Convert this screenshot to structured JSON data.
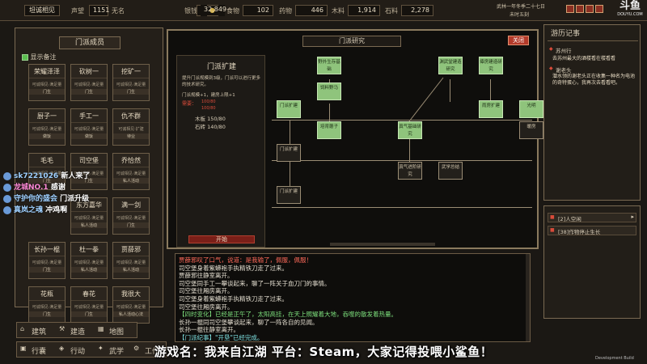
{
  "top": {
    "status": "坦诚相见",
    "rep_label": "声望",
    "rep_value": "1151",
    "rep_level": "无名",
    "resources": [
      {
        "label": "银钱",
        "value": ""
      },
      {
        "label": "",
        "value": "32,849"
      },
      {
        "label": "食物",
        "value": "102"
      },
      {
        "label": "药物",
        "value": "446"
      },
      {
        "label": "木料",
        "value": "1,914"
      },
      {
        "label": "石料",
        "value": "2,278"
      }
    ],
    "date_line": "武林一年冬季二十七日",
    "time_line": "未时五刻",
    "platform": "斗鱼",
    "platform_sub": "DOUYU.COM"
  },
  "sidebar": {
    "title": "门派成员",
    "show_notes": "显示备注",
    "members": [
      {
        "name": "荣耀泽泽",
        "s1": "可诚相见·满足量",
        "s2": "门生"
      },
      {
        "name": "砍树一",
        "s1": "可诚相见·满足量",
        "s2": "门生"
      },
      {
        "name": "挖矿一",
        "s1": "可诚相见·满足量",
        "s2": "门生"
      },
      {
        "name": "厨子一",
        "s1": "可诚相见·满足量",
        "s2": "做饭"
      },
      {
        "name": "手工一",
        "s1": "可诚相见·满足量",
        "s2": "做饭"
      },
      {
        "name": "仇不群",
        "s1": "可诚相见·扩建",
        "s2": "待业"
      },
      {
        "name": "毛毛",
        "s1": "可诚相见·满足量",
        "s2": "门生"
      },
      {
        "name": "司空堡",
        "s1": "可诚相见·满足量",
        "s2": "门生"
      },
      {
        "name": "乔恰然",
        "s1": "可诚相见·满足量",
        "s2": "私人活动"
      },
      {
        "name": "",
        "s1": "",
        "s2": ""
      },
      {
        "name": "东方嘉华",
        "s1": "可诚相见·满足量",
        "s2": "私人活动"
      },
      {
        "name": "满一剑",
        "s1": "可诚相见·满足量",
        "s2": "门生"
      },
      {
        "name": "长孙一棍",
        "s1": "可诚相见·满足量",
        "s2": "门生"
      },
      {
        "name": "杜一拳",
        "s1": "可诚相见·满足量",
        "s2": "私人活动"
      },
      {
        "name": "贾薛邪",
        "s1": "可诚相见·满足量",
        "s2": "私人活动"
      },
      {
        "name": "花瓶",
        "s1": "可诚相见·满足量",
        "s2": "门生"
      },
      {
        "name": "春花",
        "s1": "可诚相见·满足量",
        "s2": "门生"
      },
      {
        "name": "我很大",
        "s1": "可诚相见·满足量",
        "s2": "私人活动心法"
      }
    ],
    "menu1": [
      "建筑",
      "建造",
      "地图"
    ],
    "menu2": [
      "行囊",
      "行动",
      "武学",
      "工作"
    ]
  },
  "research": {
    "title": "门派研究",
    "close": "关闭",
    "detail": {
      "title": "门派扩建",
      "desc": "提升门派规模到3级，门派可以进行更多的技术研究。",
      "effects": "门派规模+1，建房上限+1",
      "need_label": "需要：",
      "need1": "100/80",
      "need2": "100/80",
      "wood": "木板  150/80",
      "stone": "石砖  140/80",
      "start": "开始"
    },
    "nodes": [
      {
        "id": "n1",
        "label": "野外生存基础",
        "dark": false
      },
      {
        "id": "n2",
        "label": "渊武堂建造研究",
        "dark": false
      },
      {
        "id": "n3",
        "label": "瘴房建造研究",
        "dark": false
      },
      {
        "id": "n4",
        "label": "门派扩建",
        "dark": false
      },
      {
        "id": "n5",
        "label": "饲料野马",
        "dark": false
      },
      {
        "id": "n6",
        "label": "雨房扩建",
        "dark": false
      },
      {
        "id": "n7",
        "label": "光明",
        "dark": false
      },
      {
        "id": "n8",
        "label": "培育蘑子",
        "dark": false
      },
      {
        "id": "n9",
        "label": "真气基础研究",
        "dark": false
      },
      {
        "id": "n10",
        "label": "门派扩建",
        "dark": true
      },
      {
        "id": "n11",
        "label": "暖房",
        "dark": true
      },
      {
        "id": "n12",
        "label": "真气进阶研究",
        "dark": true
      },
      {
        "id": "n13",
        "label": "武学总结",
        "dark": true
      },
      {
        "id": "n14",
        "label": "门派扩建",
        "dark": true
      }
    ]
  },
  "log": [
    {
      "text": "贾薛邪叹了口气，说道：是我输了，佩服，佩服！",
      "color": "#ff6a5a"
    },
    {
      "text": "司空堡身着紫蟒袍手执精铁刀走了过来。",
      "color": "#e6e0d2"
    },
    {
      "text": "贾薛邪往静室离开。",
      "color": "#e6e0d2"
    },
    {
      "text": "司空堡同手工一攀谈起来，聊了一阵关于血刀门的事情。",
      "color": "#e6e0d2"
    },
    {
      "text": "司空堡往厢房离开。",
      "color": "#e6e0d2"
    },
    {
      "text": "司空堡身着紫蟒袍手执精铁刀走了过来。",
      "color": "#e6e0d2"
    },
    {
      "text": "司空堡往厢房离开。",
      "color": "#e6e0d2"
    },
    {
      "text": "【四时变化】已经是正午了，太阳高挂，在天上照耀着大地，吞噬的散发着热量。",
      "color": "#7de07d"
    },
    {
      "text": "长孙一棍同司空堡攀谈起来，聊了一阵各自的见闻。",
      "color": "#e6e0d2"
    },
    {
      "text": "长孙一棍往静室离开。",
      "color": "#e6e0d2"
    },
    {
      "text": "【门派纪事】\"开垦\"已经完成。",
      "color": "#7de0e0"
    }
  ],
  "journal": {
    "title": "游历记事",
    "place": "苏州行",
    "place_desc": "去苏州最大的酒楼看在楼看看",
    "npc": "谢老头",
    "npc_desc": "潜水领的谢老头正在收集一种名为电池的奇特蛋心，我再次去看看吧。",
    "alerts": [
      "[2]人空闲",
      "[38]作物停止生长"
    ]
  },
  "chat": [
    {
      "user": "sk7221026",
      "msg": "新人来了"
    },
    {
      "user": "龙城NO.1",
      "msg": "感谢"
    },
    {
      "user": "守护你的盛会",
      "msg": "门派升级"
    },
    {
      "user": "真岚之魂",
      "msg": "冲鸡啊"
    }
  ],
  "subtitle": "游戏名：我来自江湖 平台：Steam，大家记得投喂小鲨鱼！",
  "dev_build": "Development Build"
}
